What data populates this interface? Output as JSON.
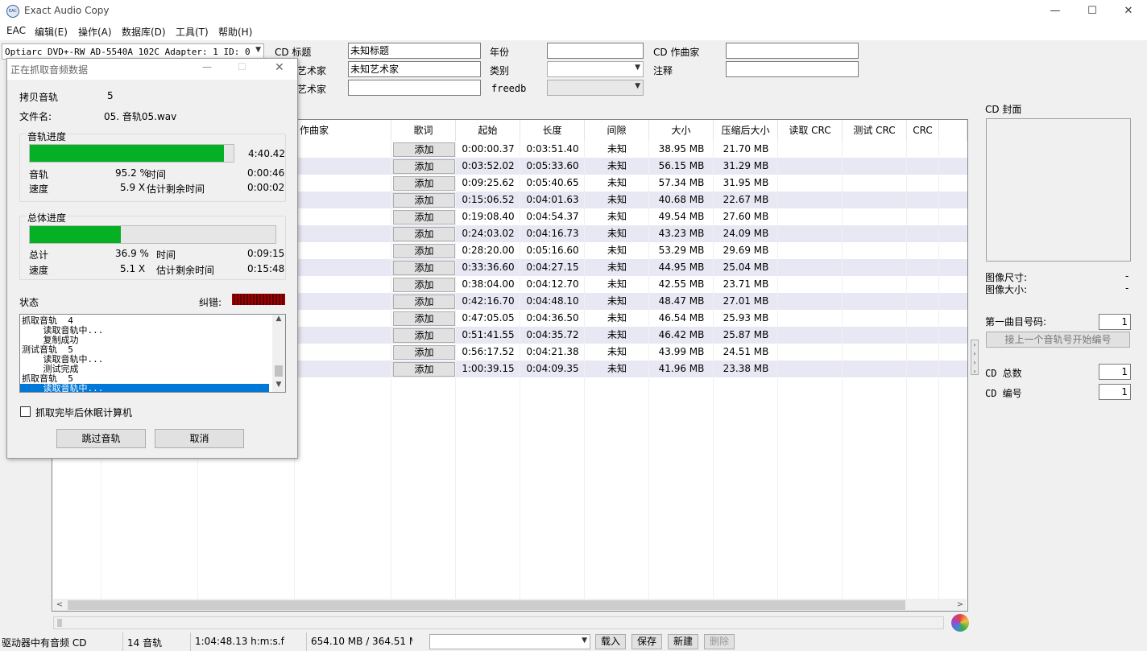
{
  "window": {
    "title": "Exact Audio Copy",
    "icon": "eac-icon",
    "minimize": "—",
    "maximize": "☐",
    "close": "✕"
  },
  "menu": [
    "EAC",
    "编辑(E)",
    "操作(A)",
    "数据库(D)",
    "工具(T)",
    "帮助(H)"
  ],
  "drive": {
    "value": "Optiarc DVD+-RW AD-5540A 102C  Adapter: 1  ID: 0"
  },
  "cd_info": {
    "title_label": "CD 标题",
    "title_value": "未知标题",
    "artist_label": "艺术家",
    "artist_value": "未知艺术家",
    "album_artist_label": "艺术家",
    "album_artist_value": "",
    "year_label": "年份",
    "year_value": "",
    "genre_label": "类别",
    "genre_value": "",
    "freedb_label": "freedb",
    "freedb_value": "",
    "composer_label": "CD 作曲家",
    "composer_value": "",
    "comment_label": "注释",
    "comment_value": ""
  },
  "table": {
    "headers": [
      "作曲家",
      "歌词",
      "起始",
      "长度",
      "间隙",
      "大小",
      "压缩后大小",
      "读取 CRC",
      "测试 CRC",
      "CRC"
    ],
    "add_label": "添加",
    "rows": [
      {
        "start": "0:00:00.37",
        "length": "0:03:51.40",
        "gap": "未知",
        "size": "38.95 MB",
        "compressed": "21.70 MB"
      },
      {
        "start": "0:03:52.02",
        "length": "0:05:33.60",
        "gap": "未知",
        "size": "56.15 MB",
        "compressed": "31.29 MB"
      },
      {
        "start": "0:09:25.62",
        "length": "0:05:40.65",
        "gap": "未知",
        "size": "57.34 MB",
        "compressed": "31.95 MB"
      },
      {
        "start": "0:15:06.52",
        "length": "0:04:01.63",
        "gap": "未知",
        "size": "40.68 MB",
        "compressed": "22.67 MB"
      },
      {
        "start": "0:19:08.40",
        "length": "0:04:54.37",
        "gap": "未知",
        "size": "49.54 MB",
        "compressed": "27.60 MB"
      },
      {
        "start": "0:24:03.02",
        "length": "0:04:16.73",
        "gap": "未知",
        "size": "43.23 MB",
        "compressed": "24.09 MB"
      },
      {
        "start": "0:28:20.00",
        "length": "0:05:16.60",
        "gap": "未知",
        "size": "53.29 MB",
        "compressed": "29.69 MB"
      },
      {
        "start": "0:33:36.60",
        "length": "0:04:27.15",
        "gap": "未知",
        "size": "44.95 MB",
        "compressed": "25.04 MB"
      },
      {
        "start": "0:38:04.00",
        "length": "0:04:12.70",
        "gap": "未知",
        "size": "42.55 MB",
        "compressed": "23.71 MB"
      },
      {
        "start": "0:42:16.70",
        "length": "0:04:48.10",
        "gap": "未知",
        "size": "48.47 MB",
        "compressed": "27.01 MB"
      },
      {
        "start": "0:47:05.05",
        "length": "0:04:36.50",
        "gap": "未知",
        "size": "46.54 MB",
        "compressed": "25.93 MB"
      },
      {
        "start": "0:51:41.55",
        "length": "0:04:35.72",
        "gap": "未知",
        "size": "46.42 MB",
        "compressed": "25.87 MB"
      },
      {
        "start": "0:56:17.52",
        "length": "0:04:21.38",
        "gap": "未知",
        "size": "43.99 MB",
        "compressed": "24.51 MB"
      },
      {
        "start": "1:00:39.15",
        "length": "0:04:09.35",
        "gap": "未知",
        "size": "41.96 MB",
        "compressed": "23.38 MB"
      }
    ]
  },
  "right_panel": {
    "cover_label": "CD 封面",
    "image_size_label": "图像尺寸:",
    "image_size_value": "-",
    "image_bytes_label": "图像大小:",
    "image_bytes_value": "-",
    "first_track_label": "第一曲目号码:",
    "first_track_value": "1",
    "renumber_button": "接上一个音轨号开始编号",
    "cd_total_label": "CD 总数",
    "cd_total_value": "1",
    "cd_number_label": "CD 编号",
    "cd_number_value": "1"
  },
  "dialog": {
    "title": "正在抓取音频数据",
    "copy_track_label": "拷贝音轨",
    "copy_track_value": "5",
    "filename_label": "文件名:",
    "filename_value": "05. 音轨05.wav",
    "track_group": "音轨进度",
    "track_time_total": "4:40.42",
    "track_label": "音轨",
    "track_percent": "95.2 %",
    "time_label": "时间",
    "track_time": "0:00:46",
    "speed_label": "速度",
    "track_speed": "5.9 X",
    "remaining_label": "估计剩余时间",
    "track_remaining": "0:00:02",
    "overall_group": "总体进度",
    "total_label": "总计",
    "total_percent": "36.9 %",
    "total_time": "0:09:15",
    "total_speed": "5.1 X",
    "total_remaining": "0:15:48",
    "track_progress": 0.952,
    "total_progress": 0.369,
    "status_label": "状态",
    "error_label": "纠错:",
    "log": [
      "抓取音轨  4",
      "    读取音轨中...",
      "    复制成功",
      "测试音轨  5",
      "    读取音轨中...",
      "    测试完成",
      "抓取音轨  5",
      "    读取音轨中..."
    ],
    "hibernate_label": "抓取完毕后休眠计算机",
    "skip_button": "跳过音轨",
    "cancel_button": "取消"
  },
  "status_bar": {
    "drive_status": "驱动器中有音频 CD",
    "tracks": "14 音轨",
    "duration": "1:04:48.13 h:m:s.f",
    "size": "654.10 MB / 364.51 M",
    "load_button": "载入",
    "save_button": "保存",
    "new_button": "新建",
    "delete_button": "删除"
  }
}
